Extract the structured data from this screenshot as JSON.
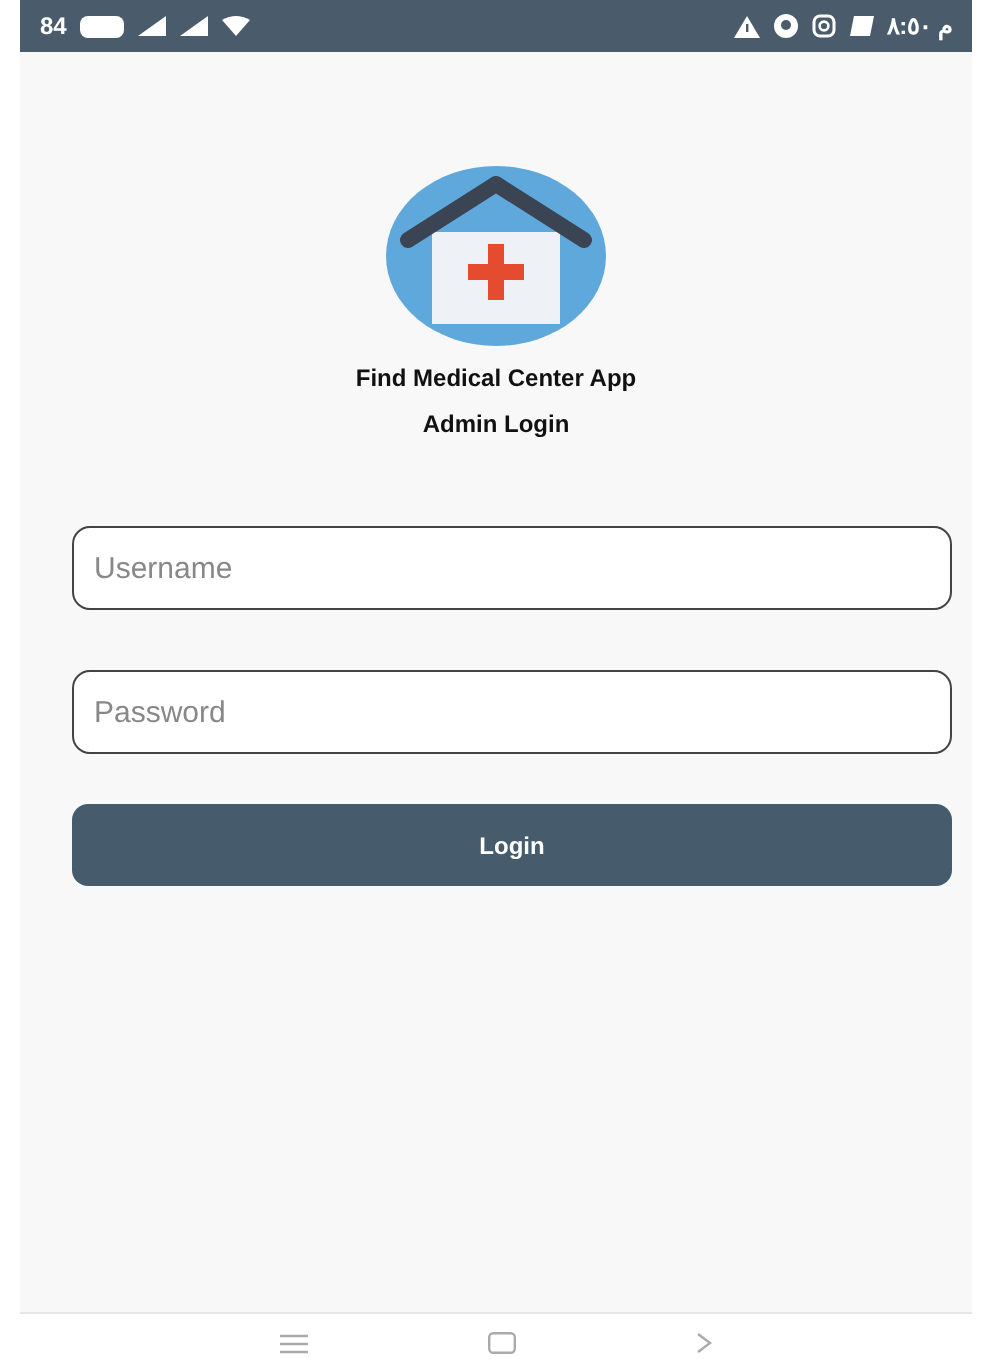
{
  "status_bar": {
    "battery": "84",
    "time": "م ٨:٥٠"
  },
  "app": {
    "title": "Find Medical Center App",
    "subtitle": "Admin Login"
  },
  "fields": [
    {
      "placeholder": "Username"
    },
    {
      "placeholder": "Password"
    }
  ],
  "login_button": {
    "label": "Login"
  }
}
